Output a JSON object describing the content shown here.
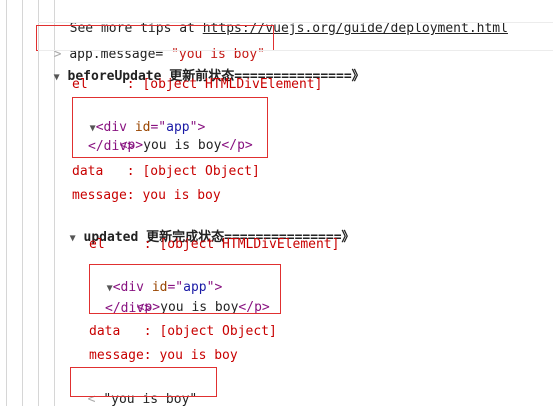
{
  "tips": {
    "text": "See more tips at ",
    "link": "https://vuejs.org/guide/deployment.html"
  },
  "command": {
    "prompt": ">",
    "prefix": "app.message= ",
    "string": "\"you is boy\""
  },
  "before_update": {
    "toggle": "▼",
    "title_code": "beforeUpdate",
    "title_cn": " 更新前状态===============》",
    "el_label": "el     : [object HTMLDivElement]",
    "div_open_lt": "<div ",
    "div_attr": "id",
    "div_eq": "=\"",
    "div_val": "app",
    "div_close_q": "\">",
    "p_open": "<p>",
    "p_text": "you is boy",
    "p_close": "</p>",
    "div_close": "</div>",
    "data_label": "data   : [object Object]",
    "message_label": "message: you is boy"
  },
  "updated": {
    "toggle": "▼",
    "title_code": "updated",
    "title_cn": " 更新完成状态===============》",
    "el_label": "el     : [object HTMLDivElement]",
    "div_open_lt": "<div ",
    "div_attr": "id",
    "div_eq": "=\"",
    "div_val": "app",
    "div_close_q": "\">",
    "p_open": "<p>",
    "p_text": "you is boy",
    "p_close": "</p>",
    "div_close": "</div>",
    "data_label": "data   : [object Object]",
    "message_label": "message: you is boy"
  },
  "result": {
    "prompt": "<",
    "value": "\"you is boy\""
  }
}
